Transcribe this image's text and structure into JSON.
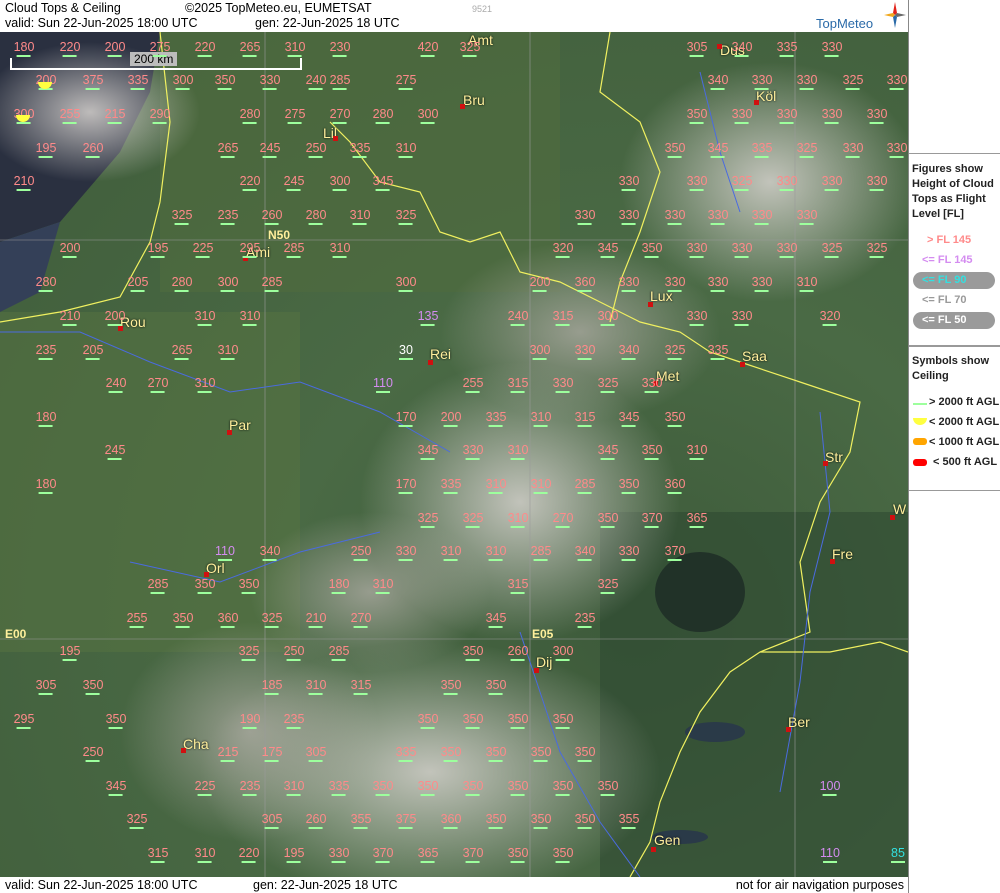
{
  "header": {
    "title": "Cloud Tops & Ceiling",
    "copyright": "©2025 TopMeteo.eu, EUMETSAT",
    "code": "9521",
    "valid": "valid:  Sun  22-Jun-2025  18:00 UTC",
    "gen": "gen: 22-Jun-2025 18 UTC",
    "brand": "TopMeteo"
  },
  "footer": {
    "valid": "valid:  Sun  22-Jun-2025  18:00 UTC",
    "gen": "gen: 22-Jun-2025 18 UTC",
    "note": "not for air navigation purposes"
  },
  "legend": {
    "tops_title": "Figures show Height of Cloud Tops as Flight Level  [FL]",
    "tops_items": [
      {
        "label": "> FL 145",
        "color": "#ff8a8a"
      },
      {
        "label": "<= FL 145",
        "color": "#d48cf0"
      },
      {
        "label": "<= FL 90",
        "color": "#33e0e0"
      },
      {
        "label": "<= FL 70",
        "color": "#9a9a9a"
      },
      {
        "label": "<= FL 50",
        "color": "#ffffff"
      }
    ],
    "ceiling_title": "Symbols show Ceiling",
    "ceiling_items": [
      {
        "label": "> 2000 ft AGL",
        "color": "#9dff9d"
      },
      {
        "label": "< 2000 ft AGL",
        "color": "#ffff40"
      },
      {
        "label": "< 1000 ft AGL",
        "color": "#ffa500"
      },
      {
        "label": "< 500 ft AGL",
        "color": "#ff0000"
      }
    ]
  },
  "map": {
    "scale_label": "200 km",
    "gridline_labels": {
      "lat": "N50",
      "lon_west": "E00",
      "lon_east": "E05"
    },
    "cities": [
      "Dus",
      "Köl",
      "Bru",
      "Lil",
      "Ami",
      "Rou",
      "Rei",
      "Lux",
      "Saa",
      "Met",
      "Par",
      "Str",
      "Orl",
      "Fre",
      "Dij",
      "Ber",
      "Cha",
      "Gen",
      "Amt",
      "W"
    ],
    "cloud_tops": [
      [
        "180",
        "220",
        "200",
        "275",
        "220",
        "265",
        "310",
        "230",
        "420",
        "325",
        "305",
        "340",
        "335",
        "330"
      ],
      [
        "200",
        "375",
        "335",
        "300",
        "350",
        "330",
        "240",
        "285",
        "275",
        "340",
        "330",
        "330",
        "325",
        "330"
      ],
      [
        "300",
        "255",
        "215",
        "290",
        "280",
        "275",
        "270",
        "280",
        "300",
        "350",
        "330",
        "330",
        "330",
        "330"
      ],
      [
        "195",
        "260",
        "265",
        "245",
        "250",
        "335",
        "310",
        "350",
        "345",
        "335",
        "325",
        "330",
        "330"
      ],
      [
        "210",
        "220",
        "245",
        "300",
        "345",
        "330",
        "330",
        "325",
        "330",
        "330",
        "330"
      ],
      [
        "325",
        "235",
        "260",
        "280",
        "310",
        "325",
        "330",
        "330",
        "330",
        "330",
        "330",
        "330"
      ],
      [
        "200",
        "195",
        "225",
        "295",
        "285",
        "310",
        "320",
        "345",
        "350",
        "330",
        "330",
        "330",
        "325",
        "325"
      ],
      [
        "280",
        "205",
        "280",
        "300",
        "285",
        "300",
        "200",
        "360",
        "330",
        "330",
        "330",
        "330",
        "310"
      ],
      [
        "210",
        "200",
        "310",
        "310",
        "135",
        "240",
        "315",
        "300",
        "330",
        "330",
        "320"
      ],
      [
        "235",
        "205",
        "265",
        "310",
        "30",
        "300",
        "330",
        "340",
        "325",
        "335"
      ],
      [
        "240",
        "270",
        "310",
        "110",
        "255",
        "315",
        "330",
        "325",
        "330"
      ],
      [
        "180",
        "170",
        "200",
        "335",
        "310",
        "315",
        "345",
        "350"
      ],
      [
        "245",
        "345",
        "330",
        "310",
        "345",
        "350",
        "310"
      ],
      [
        "180",
        "170",
        "335",
        "310",
        "310",
        "285",
        "350",
        "360"
      ],
      [
        "325",
        "325",
        "310",
        "270",
        "350",
        "370",
        "365"
      ],
      [
        "110",
        "340",
        "250",
        "330",
        "310",
        "310",
        "285",
        "340",
        "330",
        "370"
      ],
      [
        "285",
        "350",
        "350",
        "180",
        "310",
        "315",
        "325"
      ],
      [
        "255",
        "350",
        "360",
        "325",
        "210",
        "270",
        "345",
        "235"
      ],
      [
        "195",
        "325",
        "250",
        "285",
        "350",
        "260",
        "300"
      ],
      [
        "305",
        "350",
        "185",
        "310",
        "315",
        "350",
        "350"
      ],
      [
        "295",
        "350",
        "190",
        "235",
        "350",
        "350",
        "350",
        "350"
      ],
      [
        "250",
        "215",
        "175",
        "305",
        "335",
        "350",
        "350",
        "350",
        "350"
      ],
      [
        "345",
        "225",
        "235",
        "310",
        "335",
        "350",
        "350",
        "350",
        "350",
        "350",
        "350",
        "100"
      ],
      [
        "325",
        "305",
        "260",
        "355",
        "375",
        "360",
        "350",
        "350",
        "350",
        "355"
      ],
      [
        "315",
        "310",
        "220",
        "195",
        "330",
        "370",
        "365",
        "370",
        "350",
        "350",
        "110",
        "85"
      ]
    ]
  }
}
